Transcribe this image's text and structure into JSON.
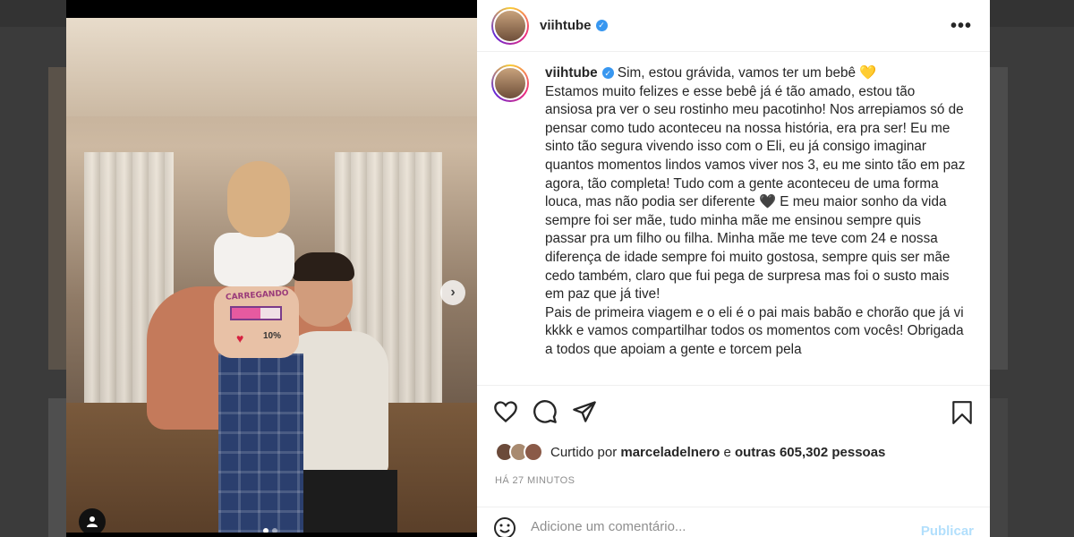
{
  "post": {
    "username": "viihtube",
    "verified_badge": "✓",
    "more_icon": "•••",
    "caption_username": "viihtube",
    "caption_body": "Sim, estou grávida, vamos ter um bebê 💛\nEstamos muito felizes e esse bebê já é tão amado, estou tão ansiosa pra ver o seu rostinho meu pacotinho! Nos arrepiamos só de pensar como tudo aconteceu na nossa história, era pra ser! Eu me sinto tão segura vivendo isso com o Eli, eu já consigo imaginar quantos momentos lindos vamos viver nos 3, eu me sinto tão em paz agora, tão completa! Tudo com a gente aconteceu de uma forma louca, mas não podia ser diferente 🖤 E meu maior sonho da vida sempre foi ser mãe, tudo minha mãe me ensinou sempre quis passar pra um filho ou filha. Minha mãe me teve com 24 e nossa diferença de idade sempre foi muito gostosa, sempre quis ser mãe cedo também, claro que fui pega de surpresa mas foi o susto mais em paz que já tive!\nPais de primeira viagem e o eli é o pai mais babão e chorão que já vi kkkk e vamos compartilhar todos os momentos com vocês! Obrigada a todos que apoiam a gente e torcem pela",
    "likes_prefix": "Curtido por",
    "likes_user": "marceladelnero",
    "likes_conjunction": "e",
    "likes_others": "outras 605,302 pessoas",
    "time": "HÁ 27 MINUTOS"
  },
  "photo": {
    "belly_text": "CARREGANDO",
    "belly_percent": "10%",
    "loading_fraction": 0.6,
    "carousel_index": 1,
    "carousel_count": 2,
    "next_icon": "›"
  },
  "comment": {
    "placeholder": "Adicione um comentário...",
    "publish_label": "Publicar",
    "publish_color": "#b2dffc"
  },
  "icons": [
    "heart-icon",
    "comment-icon",
    "share-icon",
    "bookmark-icon",
    "emoji-icon",
    "more-icon",
    "user-tag-icon",
    "verified-icon"
  ],
  "colors": {
    "verified": "#3897f0",
    "text": "#262626",
    "muted": "#8e8e8e"
  }
}
